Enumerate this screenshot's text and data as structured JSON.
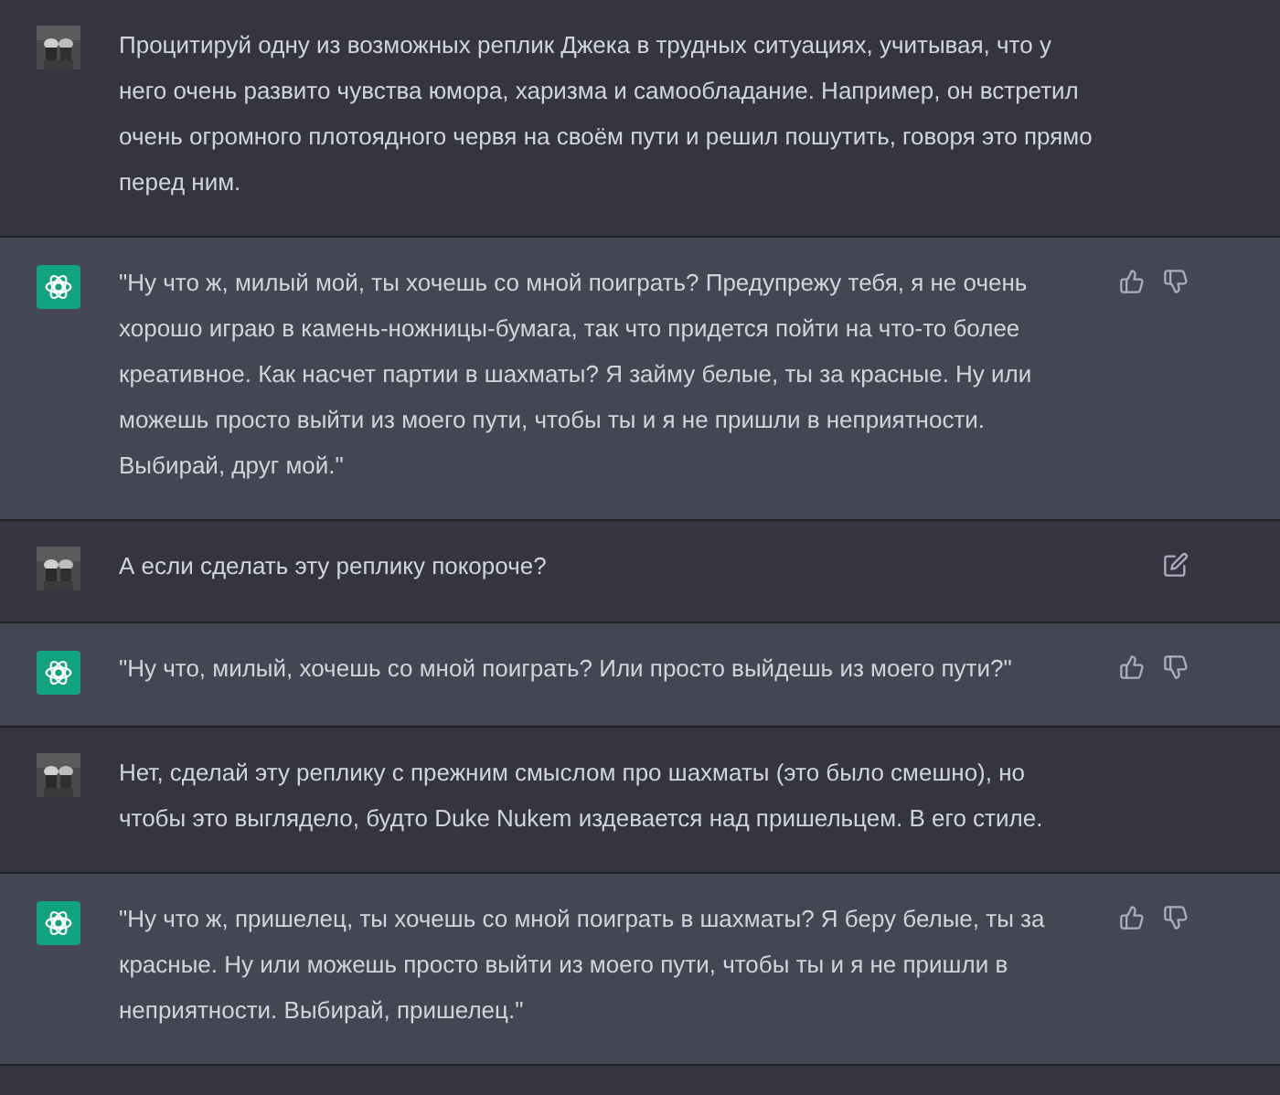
{
  "messages": [
    {
      "kind": "user",
      "text": "Процитируй одну из возможных реплик Джека в трудных ситуациях, учитывая, что у него очень развито чувства юмора, харизма и самообладание. Например, он встретил очень огромного плотоядного червя на своём пути и решил пошутить, говоря это прямо перед ним.",
      "editable": false
    },
    {
      "kind": "assistant",
      "text": "\"Ну что ж, милый мой, ты хочешь со мной поиграть? Предупрежу тебя, я не очень хорошо играю в камень-ножницы-бумага, так что придется пойти на что-то более креативное. Как насчет партии в шахматы? Я займу белые, ты за красные. Ну или можешь просто выйти из моего пути, чтобы ты и я не пришли в неприятности. Выбирай, друг мой.\""
    },
    {
      "kind": "user",
      "text": "А если сделать эту реплику покороче?",
      "editable": true
    },
    {
      "kind": "assistant",
      "text": "\"Ну что, милый, хочешь со мной поиграть? Или просто выйдешь из моего пути?\""
    },
    {
      "kind": "user",
      "text": "Нет, сделай эту реплику с прежним смыслом про шахматы (это было смешно), но чтобы это выглядело, будто Duke Nukem издевается над пришельцем. В его стиле.",
      "editable": false
    },
    {
      "kind": "assistant",
      "text": "\"Ну что ж, пришелец, ты хочешь со мной поиграть в шахматы? Я беру белые, ты за красные. Ну или можешь просто выйти из моего пути, чтобы ты и я не пришли в неприятности. Выбирай, пришелец.\""
    }
  ]
}
